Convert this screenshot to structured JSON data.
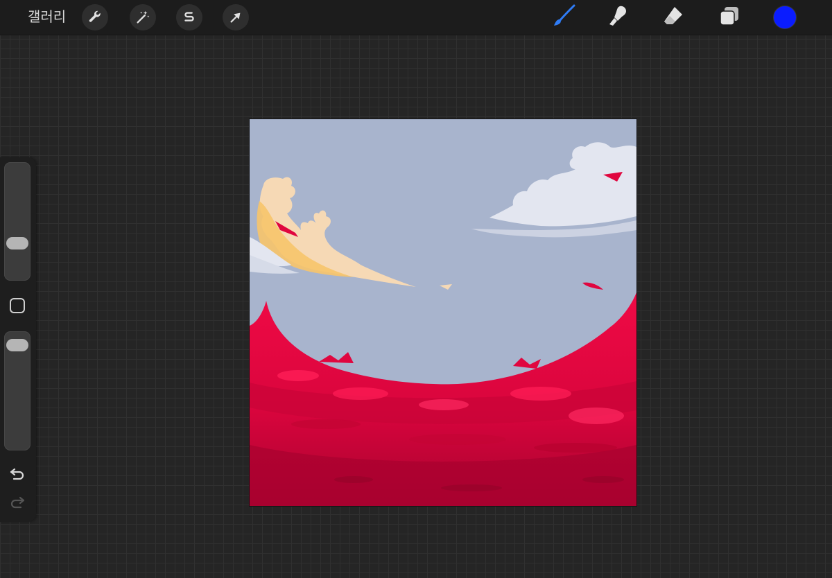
{
  "topbar": {
    "gallery_label": "갤러리",
    "left_tools": [
      {
        "name": "actions",
        "icon": "wrench-icon"
      },
      {
        "name": "adjustments",
        "icon": "magic-wand-icon"
      },
      {
        "name": "selection",
        "icon": "selection-s-icon"
      },
      {
        "name": "transform",
        "icon": "arrow-cursor-icon"
      }
    ],
    "right_tools": [
      {
        "name": "brush",
        "icon": "brush-icon",
        "active": true
      },
      {
        "name": "smudge",
        "icon": "smudge-finger-icon",
        "active": false
      },
      {
        "name": "eraser",
        "icon": "eraser-icon",
        "active": false
      },
      {
        "name": "layers",
        "icon": "layers-icon",
        "active": false
      }
    ],
    "current_color": "#0a1cff"
  },
  "sidebar": {
    "brush_size_level": 0.28,
    "opacity_level": 0.95,
    "modify_icon": "square-icon",
    "undo_icon": "undo-arrow-icon",
    "redo_icon": "redo-arrow-icon"
  },
  "canvas": {
    "sky_color": "#a8b4cd",
    "ground_color": "#e0063f",
    "cloud_color": "#e3e6f0",
    "highlight_color": "#f6d9b5",
    "accent_color": "#f7c46a"
  }
}
